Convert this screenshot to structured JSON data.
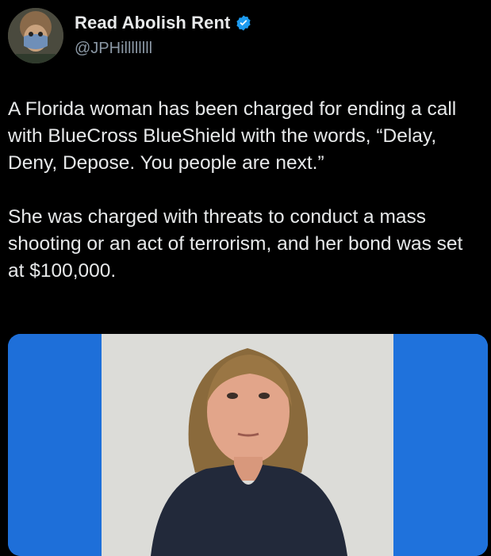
{
  "author": {
    "display_name": "Read Abolish Rent",
    "handle": "@JPHillllllll",
    "verified": true,
    "avatar_icon": "profile-photo-masked-person"
  },
  "tweet": {
    "text": "A Florida woman has been charged for ending a call with BlueCross BlueShield with the words, “Delay, Deny, Depose. You people are next.”\n\nShe was charged with threats to conduct a mass shooting or an act of terrorism, and her bond was set at $100,000."
  },
  "media": {
    "type": "photo",
    "subject": "mugshot-photo"
  },
  "colors": {
    "background": "#000000",
    "text": "#e7e9ea",
    "secondary_text": "#8b98a5",
    "verified_badge": "#1d9bf0",
    "photo_backdrop_blue": "#1e6fd9"
  }
}
